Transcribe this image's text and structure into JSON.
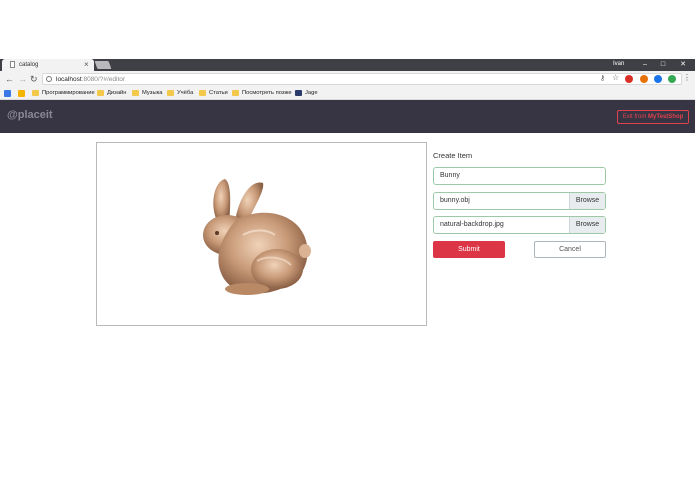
{
  "browser": {
    "tab_title": "catalog",
    "tab_close": "×",
    "user_name": "Ivan",
    "window_controls": {
      "minimize": "–",
      "maximize": "□",
      "close": "✕"
    },
    "url_host": "localhost",
    "url_rest": ":8080/?#/editor",
    "nav": {
      "back": "←",
      "forward": "→",
      "reload": "↻"
    },
    "bookmarks": [
      {
        "label": "",
        "icon": "apps-icon"
      },
      {
        "label": "",
        "icon": "bookmark-star-icon"
      },
      {
        "label": "Программирование",
        "icon": "folder-icon"
      },
      {
        "label": "Дизайн",
        "icon": "folder-icon"
      },
      {
        "label": "Музыка",
        "icon": "folder-icon"
      },
      {
        "label": "Учёба",
        "icon": "folder-icon"
      },
      {
        "label": "Статьи",
        "icon": "folder-icon"
      },
      {
        "label": "Посмотреть позже",
        "icon": "folder-icon"
      },
      {
        "label": "Jage",
        "icon": "jage-icon"
      }
    ]
  },
  "app": {
    "logo": "@placeit",
    "exit_prefix": "Exit from ",
    "exit_shop": "MyTestShop"
  },
  "form": {
    "title": "Create Item",
    "name_value": "Bunny",
    "model_file": "bunny.obj",
    "backdrop_file": "natural-backdrop.jpg",
    "browse_label": "Browse",
    "submit_label": "Submit",
    "cancel_label": "Cancel"
  },
  "colors": {
    "appbar": "#373543",
    "accent_red": "#dc3545",
    "field_border": "#9ccaa8",
    "bunny": "#c89a78"
  }
}
